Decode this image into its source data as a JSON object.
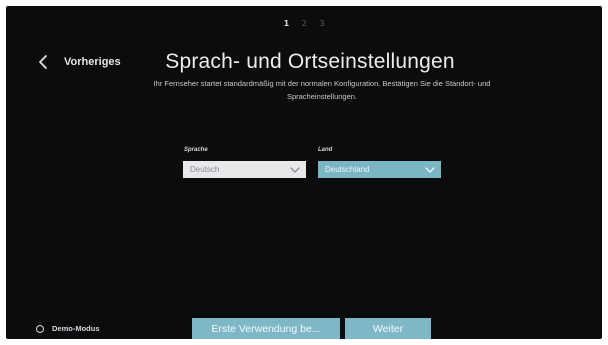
{
  "steps": [
    "1",
    "2",
    "3"
  ],
  "header": {
    "back_label": "Vorheriges",
    "title": "Sprach- und Ortseinstellungen",
    "subtitle": "Ihr Fernseher startet standardmäßig mit der normalen Konfiguration. Bestätigen Sie die Standort- und Spracheinstellungen."
  },
  "form": {
    "language": {
      "label": "Sprache",
      "value": "Deutsch"
    },
    "country": {
      "label": "Land",
      "value": "Deutschland"
    }
  },
  "footer": {
    "demo_label": "Demo-Modus",
    "demo_selected": false,
    "first_use_label": "Erste Verwendung be...",
    "next_label": "Weiter"
  },
  "colors": {
    "background": "#0c0c0e",
    "accent": "#7eb8c7",
    "dropdown_light": "#e6e8ea",
    "text": "#ececee"
  },
  "icons": {
    "back": "chevron-left-icon",
    "dropdown": "chevron-down-icon",
    "radio": "radio-empty-icon"
  }
}
